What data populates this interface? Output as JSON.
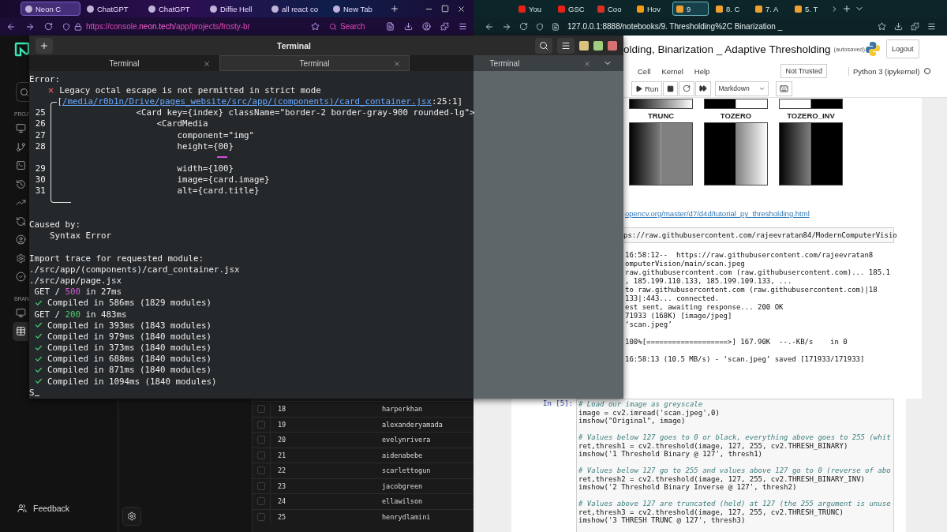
{
  "left_browser": {
    "tabs": [
      {
        "label": "Neon C",
        "selected": true
      },
      {
        "label": "ChatGPT",
        "selected": false
      },
      {
        "label": "ChatGPT",
        "selected": false
      },
      {
        "label": "Diffie Hell",
        "selected": false
      },
      {
        "label": "all react co",
        "selected": false
      },
      {
        "label": "New Tab",
        "selected": false
      }
    ],
    "url": {
      "scheme": "https://console.",
      "domain": "neon.tech",
      "path": "/app/projects/frosty-br"
    },
    "search": "Search"
  },
  "right_browser": {
    "tabs": [
      {
        "label": "You",
        "selected": false,
        "color": "#e62117"
      },
      {
        "label": "GSC",
        "selected": false,
        "color": "#e62117"
      },
      {
        "label": "Coo",
        "selected": false,
        "color": "#d93025"
      },
      {
        "label": "Hov",
        "selected": false,
        "color": "#f39c12"
      },
      {
        "label": "9",
        "selected": true,
        "color": "#f0a030"
      },
      {
        "label": "8. C",
        "selected": false,
        "color": "#f0a030"
      },
      {
        "label": "7. A",
        "selected": false,
        "color": "#f0a030"
      },
      {
        "label": "5. T",
        "selected": false,
        "color": "#f0a030"
      }
    ],
    "url": "127.0.0.1:8888/notebooks/9. Thresholding%2C Binarization _"
  },
  "neon": {
    "project_label": "PROJ",
    "nav": [
      {
        "kind": "dashboard",
        "selected": false
      },
      {
        "kind": "branches",
        "selected": false
      },
      {
        "kind": "sql",
        "selected": false
      },
      {
        "kind": "restore",
        "selected": false
      },
      {
        "kind": "monitoring",
        "selected": false
      },
      {
        "kind": "integrations",
        "selected": false
      },
      {
        "kind": "authorize",
        "selected": false
      },
      {
        "kind": "settings",
        "selected": false
      },
      {
        "kind": "check",
        "selected": false
      }
    ],
    "branch_label": "BRAN",
    "branch_nav": [
      {
        "kind": "overview",
        "selected": false
      },
      {
        "kind": "tables",
        "selected": true
      }
    ],
    "feedback": "Feedback",
    "rows": [
      {
        "id": "18",
        "name": "harperkhan",
        "checked": false
      },
      {
        "id": "19",
        "name": "alexanderyamada",
        "checked": false
      },
      {
        "id": "20",
        "name": "evelynrivera",
        "checked": false
      },
      {
        "id": "21",
        "name": "aidenabebe",
        "checked": false
      },
      {
        "id": "22",
        "name": "scarlettogun",
        "checked": false
      },
      {
        "id": "23",
        "name": "jacobgreen",
        "checked": false
      },
      {
        "id": "24",
        "name": "ellawilson",
        "checked": false
      },
      {
        "id": "25",
        "name": "henrydlamini",
        "checked": false
      }
    ]
  },
  "terminal": {
    "title": "Terminal",
    "tabs": [
      {
        "label": "Terminal",
        "selected": false
      },
      {
        "label": "Terminal",
        "selected": true
      },
      {
        "label": "Terminal",
        "selected": false
      }
    ],
    "lines": [
      {
        "kind": "plain",
        "text": "Error:"
      },
      {
        "kind": "error",
        "text": "Legacy octal escape is not permitted in strict mode"
      },
      {
        "kind": "path",
        "prefix": "[",
        "link": "/media/r0b1n/Drive/pages_website/src/app/(components)/card_container.jsx",
        "text": ":25:1]"
      },
      {
        "kind": "code",
        "num": "25",
        "text": "<Card key={index} className=\"border-2 border-gray-900 rounded-lg\">"
      },
      {
        "kind": "code",
        "num": "26",
        "text": "    <CardMedia"
      },
      {
        "kind": "code",
        "num": "27",
        "text": "        component=\"img\""
      },
      {
        "kind": "code",
        "num": "28",
        "text": "        height={00}"
      },
      {
        "kind": "marker"
      },
      {
        "kind": "code",
        "num": "29",
        "text": "        width={100}"
      },
      {
        "kind": "code",
        "num": "30",
        "text": "        image={card.image}"
      },
      {
        "kind": "code",
        "num": "31",
        "text": "        alt={card.title}"
      },
      {
        "kind": "end"
      },
      {
        "kind": "blank"
      },
      {
        "kind": "plain",
        "text": "Caused by:"
      },
      {
        "kind": "plain",
        "text": "    Syntax Error"
      },
      {
        "kind": "blank"
      },
      {
        "kind": "plain",
        "text": "Import trace for requested module:"
      },
      {
        "kind": "plain",
        "text": "./src/app/(components)/card_container.jsx"
      },
      {
        "kind": "plain",
        "text": "./src/app/page.jsx"
      },
      {
        "kind": "request",
        "method": "GET / ",
        "status": "500",
        "rest": " in 27ms",
        "color": "#d45fd4"
      },
      {
        "kind": "compiled",
        "text": "Compiled in 586ms (1829 modules)"
      },
      {
        "kind": "request",
        "method": "GET / ",
        "status": "200",
        "rest": " in 483ms",
        "color": "#4ccf6a"
      },
      {
        "kind": "compiled",
        "text": "Compiled in 393ms (1843 modules)"
      },
      {
        "kind": "compiled",
        "text": "Compiled in 979ms (1840 modules)"
      },
      {
        "kind": "compiled",
        "text": "Compiled in 373ms (1840 modules)"
      },
      {
        "kind": "compiled",
        "text": "Compiled in 688ms (1840 modules)"
      },
      {
        "kind": "compiled",
        "text": "Compiled in 871ms (1840 modules)"
      },
      {
        "kind": "compiled",
        "text": "Compiled in 1094ms (1840 modules)"
      },
      {
        "kind": "prompt",
        "text": "S"
      }
    ]
  },
  "notebook": {
    "title": "olding, Binarization _ Adaptive Thresholding",
    "status": "(autosaved)",
    "logout": "Logout",
    "menu": [
      "Cell",
      "Kernel",
      "Help"
    ],
    "trust": "Not Trusted",
    "kernel": "Python 3 (ipykernel)",
    "kernel_busy": false,
    "run": "Run",
    "cell_type": "Markdown",
    "upper_images": [
      {
        "kind": "gradient"
      },
      {
        "kind": "binary"
      },
      {
        "kind": "binary_inv"
      }
    ],
    "figures": [
      {
        "label": "TRUNC",
        "kind": "trunc"
      },
      {
        "label": "TOZERO",
        "kind": "tozero"
      },
      {
        "label": "TOZERO_INV",
        "kind": "tozero_inv"
      }
    ],
    "link": "opencv.org/master/d7/d4d/tutorial_py_thresholding.html",
    "wget_input": "ps://raw.githubusercontent.com/rajeevratan84/ModernComputerVisio",
    "wget_output": [
      [
        "16:58:12--  https://raw.githubusercontent.com/rajeevratan8",
        "omputerVision/main/scan.jpeg",
        "raw.githubusercontent.com (raw.githubusercontent.com)... 185.1",
        ", 185.199.110.133, 185.199.109.133, ...",
        "to raw.githubusercontent.com (raw.githubusercontent.com)|18",
        "133|:443... connected.",
        "est sent, awaiting response... 200 OK",
        "71933 (168K) [image/jpeg]",
        "‘scan.jpeg’"
      ],
      [
        "100%[===================>] 167.90K  --.-KB/s    in 0"
      ],
      [
        "16:58:13 (10.5 MB/s) - ‘scan.jpeg’ saved [171933/171933]"
      ]
    ],
    "code_prompt": "In [5]:",
    "code_blocks": [
      [
        {
          "kind": "comment",
          "text": "# Load our image as greyscale"
        },
        {
          "kind": "code",
          "text": "image = cv2.imread('scan.jpeg',0)"
        },
        {
          "kind": "code",
          "text": "imshow(\"Original\", image)"
        }
      ],
      [
        {
          "kind": "comment",
          "text": "# Values below 127 goes to 0 or black, everything above goes to 255 (whit"
        },
        {
          "kind": "code",
          "text": "ret,thresh1 = cv2.threshold(image, 127, 255, cv2.THRESH_BINARY)"
        },
        {
          "kind": "code",
          "text": "imshow('1 Threshold Binary @ 127', thresh1)"
        }
      ],
      [
        {
          "kind": "comment",
          "text": "# Values below 127 go to 255 and values above 127 go to 0 (reverse of abo"
        },
        {
          "kind": "code",
          "text": "ret,thresh2 = cv2.threshold(image, 127, 255, cv2.THRESH_BINARY_INV)"
        },
        {
          "kind": "code",
          "text": "imshow('2 Threshold Binary Inverse @ 127', thresh2)"
        }
      ],
      [
        {
          "kind": "comment",
          "text": "# Values above 127 are truncated (held) at 127 (the 255 argument is unuse"
        },
        {
          "kind": "code",
          "text": "ret,thresh3 = cv2.threshold(image, 127, 255, cv2.THRESH_TRUNC)"
        },
        {
          "kind": "code",
          "text": "imshow('3 THRESH TRUNC @ 127', thresh3)"
        }
      ]
    ]
  }
}
